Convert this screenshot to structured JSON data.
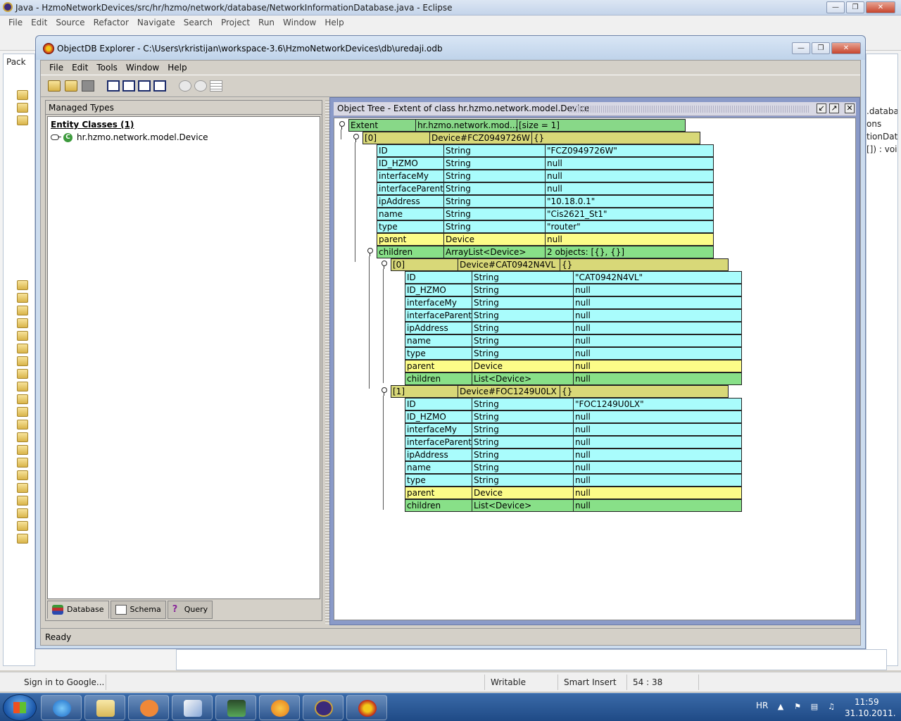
{
  "eclipse": {
    "title": "Java - HzmoNetworkDevices/src/hr/hzmo/network/database/NetworkInformationDatabase.java - Eclipse",
    "menu": [
      "File",
      "Edit",
      "Source",
      "Refactor",
      "Navigate",
      "Search",
      "Project",
      "Run",
      "Window",
      "Help"
    ],
    "left_view_label": "Pack",
    "right_code": [
      ".databas",
      "ons",
      "tionData",
      "[]) : void"
    ],
    "status": {
      "signin": "Sign in to Google...",
      "writable": "Writable",
      "insert_mode": "Smart Insert",
      "position": "54 : 38"
    }
  },
  "odb": {
    "title": "ObjectDB Explorer - C:\\Users\\rkristijan\\workspace-3.6\\HzmoNetworkDevices\\db\\uredaji.odb",
    "menu": {
      "file": "File",
      "edit": "Edit",
      "tools": "Tools",
      "window": "Window",
      "help": "Help"
    },
    "managed_header": "Managed Types",
    "entity_classes": "Entity Classes (1)",
    "entity_class": "hr.hzmo.network.model.Device",
    "tabs": {
      "database": "Database",
      "schema": "Schema",
      "query": "Query"
    },
    "status": "Ready",
    "tree_title": "Object Tree - Extent of class hr.hzmo.network.model.Device"
  },
  "tree": {
    "extent": {
      "label": "Extent",
      "cls": "hr.hzmo.network.mod...",
      "size": "[size = 1]"
    },
    "root": {
      "index": "[0]",
      "ref": "Device#FCZ0949726W",
      "braces": "{}"
    },
    "root_fields": [
      {
        "name": "ID",
        "type": "String",
        "value": "\"FCZ0949726W\"",
        "kind": "cyan"
      },
      {
        "name": "ID_HZMO",
        "type": "String",
        "value": "null",
        "kind": "cyan"
      },
      {
        "name": "interfaceMy",
        "type": "String",
        "value": "null",
        "kind": "cyan"
      },
      {
        "name": "interfaceParent",
        "type": "String",
        "value": "null",
        "kind": "cyan"
      },
      {
        "name": "ipAddress",
        "type": "String",
        "value": "\"10.18.0.1\"",
        "kind": "cyan"
      },
      {
        "name": "name",
        "type": "String",
        "value": "\"Cis2621_St1\"",
        "kind": "cyan"
      },
      {
        "name": "type",
        "type": "String",
        "value": "\"router\"",
        "kind": "cyan"
      },
      {
        "name": "parent",
        "type": "Device",
        "value": "null",
        "kind": "yellow"
      },
      {
        "name": "children",
        "type": "ArrayList<Device>",
        "value": "2 objects: [{}, {}]",
        "kind": "green"
      }
    ],
    "children": [
      {
        "index": "[0]",
        "ref": "Device#CAT0942N4VL",
        "braces": "{}",
        "fields": [
          {
            "name": "ID",
            "type": "String",
            "value": "\"CAT0942N4VL\"",
            "kind": "cyan"
          },
          {
            "name": "ID_HZMO",
            "type": "String",
            "value": "null",
            "kind": "cyan"
          },
          {
            "name": "interfaceMy",
            "type": "String",
            "value": "null",
            "kind": "cyan"
          },
          {
            "name": "interfaceParent",
            "type": "String",
            "value": "null",
            "kind": "cyan"
          },
          {
            "name": "ipAddress",
            "type": "String",
            "value": "null",
            "kind": "cyan"
          },
          {
            "name": "name",
            "type": "String",
            "value": "null",
            "kind": "cyan"
          },
          {
            "name": "type",
            "type": "String",
            "value": "null",
            "kind": "cyan"
          },
          {
            "name": "parent",
            "type": "Device",
            "value": "null",
            "kind": "yellow"
          },
          {
            "name": "children",
            "type": "List<Device>",
            "value": "null",
            "kind": "green"
          }
        ]
      },
      {
        "index": "[1]",
        "ref": "Device#FOC1249U0LX",
        "braces": "{}",
        "fields": [
          {
            "name": "ID",
            "type": "String",
            "value": "\"FOC1249U0LX\"",
            "kind": "cyan"
          },
          {
            "name": "ID_HZMO",
            "type": "String",
            "value": "null",
            "kind": "cyan"
          },
          {
            "name": "interfaceMy",
            "type": "String",
            "value": "null",
            "kind": "cyan"
          },
          {
            "name": "interfaceParent",
            "type": "String",
            "value": "null",
            "kind": "cyan"
          },
          {
            "name": "ipAddress",
            "type": "String",
            "value": "null",
            "kind": "cyan"
          },
          {
            "name": "name",
            "type": "String",
            "value": "null",
            "kind": "cyan"
          },
          {
            "name": "type",
            "type": "String",
            "value": "null",
            "kind": "cyan"
          },
          {
            "name": "parent",
            "type": "Device",
            "value": "null",
            "kind": "yellow"
          },
          {
            "name": "children",
            "type": "List<Device>",
            "value": "null",
            "kind": "green"
          }
        ]
      }
    ]
  },
  "taskbar": {
    "lang": "HR",
    "time": "11:59",
    "date": "31.10.2011."
  }
}
